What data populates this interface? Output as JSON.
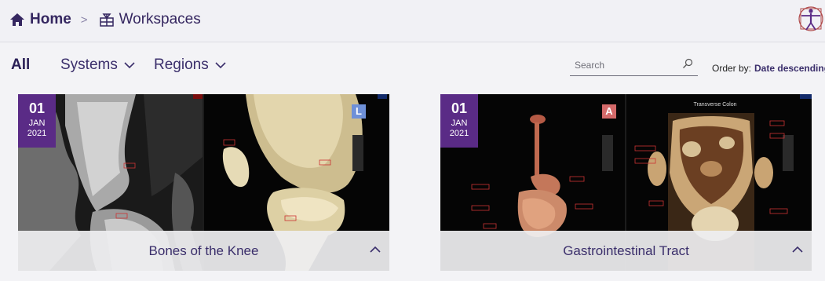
{
  "breadcrumb": {
    "home_label": "Home",
    "separator": ">",
    "current_label": "Workspaces"
  },
  "filters": {
    "all_label": "All",
    "systems_label": "Systems",
    "regions_label": "Regions"
  },
  "search": {
    "placeholder": "Search"
  },
  "order": {
    "label": "Order by:",
    "value": "Date descending"
  },
  "cards": [
    {
      "day": "01",
      "month": "JAN",
      "year": "2021",
      "title": "Bones of the Knee",
      "view_letter": "L"
    },
    {
      "day": "01",
      "month": "JAN",
      "year": "2021",
      "title": "Gastrointestinal Tract",
      "view_letter": "A",
      "panel_title": "Transverse Colon"
    }
  ],
  "colors": {
    "brand": "#352760",
    "badge": "#5a2b86"
  }
}
